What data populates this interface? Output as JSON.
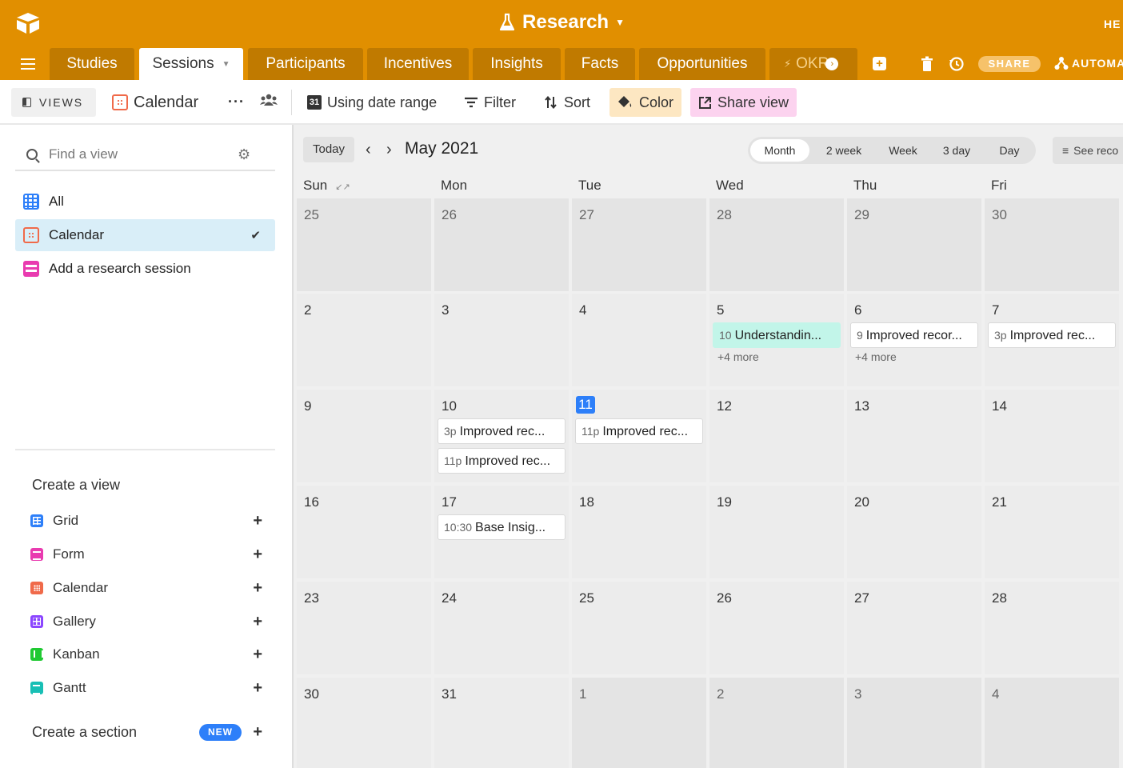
{
  "header": {
    "base_name": "Research",
    "help_label": "HE",
    "logo_icon": "airtable-logo-icon",
    "title_icon": "flask-icon"
  },
  "tabs": [
    {
      "label": "Studies",
      "active": false
    },
    {
      "label": "Sessions",
      "active": true
    },
    {
      "label": "Participants",
      "active": false
    },
    {
      "label": "Incentives",
      "active": false
    },
    {
      "label": "Insights",
      "active": false
    },
    {
      "label": "Facts",
      "active": false
    },
    {
      "label": "Opportunities",
      "active": false
    },
    {
      "label": "OKR",
      "active": false
    }
  ],
  "toolbar_right": {
    "share_label": "SHARE",
    "automations_label": "AUTOMA"
  },
  "viewbar": {
    "views_label": "VIEWS",
    "current_view": "Calendar",
    "date_range_label": "Using date range",
    "date_icon_text": "31",
    "filter_label": "Filter",
    "sort_label": "Sort",
    "color_label": "Color",
    "share_view_label": "Share view"
  },
  "sidebar": {
    "search_placeholder": "Find a view",
    "views": [
      {
        "label": "All",
        "icon": "grid-view-icon",
        "selected": false
      },
      {
        "label": "Calendar",
        "icon": "calendar-view-icon",
        "selected": true
      },
      {
        "label": "Add a research session",
        "icon": "form-view-icon",
        "selected": false
      }
    ],
    "create_view_heading": "Create a view",
    "create_options": [
      {
        "label": "Grid",
        "icon": "grid-icon"
      },
      {
        "label": "Form",
        "icon": "form-icon"
      },
      {
        "label": "Calendar",
        "icon": "calendar-icon"
      },
      {
        "label": "Gallery",
        "icon": "gallery-icon"
      },
      {
        "label": "Kanban",
        "icon": "kanban-icon"
      },
      {
        "label": "Gantt",
        "icon": "gantt-icon"
      }
    ],
    "create_section_label": "Create a section",
    "new_badge": "NEW"
  },
  "calendar": {
    "today_label": "Today",
    "month_label": "May 2021",
    "ranges": [
      "Month",
      "2 week",
      "Week",
      "3 day",
      "Day"
    ],
    "active_range": "Month",
    "see_records_label": "See reco",
    "weekdays": [
      "Sun",
      "Mon",
      "Tue",
      "Wed",
      "Thu",
      "Fri"
    ],
    "weeks": [
      [
        {
          "d": "25",
          "cur": false
        },
        {
          "d": "26",
          "cur": false
        },
        {
          "d": "27",
          "cur": false
        },
        {
          "d": "28",
          "cur": false
        },
        {
          "d": "29",
          "cur": false
        },
        {
          "d": "30",
          "cur": false
        }
      ],
      [
        {
          "d": "2",
          "cur": true
        },
        {
          "d": "3",
          "cur": true
        },
        {
          "d": "4",
          "cur": true
        },
        {
          "d": "5",
          "cur": true,
          "events": [
            {
              "time": "10",
              "title": "Understandin...",
              "teal": true
            }
          ],
          "more": "+4 more"
        },
        {
          "d": "6",
          "cur": true,
          "events": [
            {
              "time": "9",
              "title": "Improved recor..."
            }
          ],
          "more": "+4 more"
        },
        {
          "d": "7",
          "cur": true,
          "events": [
            {
              "time": "3p",
              "title": "Improved rec..."
            }
          ]
        }
      ],
      [
        {
          "d": "9",
          "cur": true
        },
        {
          "d": "10",
          "cur": true,
          "events": [
            {
              "time": "3p",
              "title": "Improved rec..."
            },
            {
              "time": "11p",
              "title": "Improved rec..."
            }
          ]
        },
        {
          "d": "11",
          "cur": true,
          "today": true,
          "events": [
            {
              "time": "11p",
              "title": "Improved rec..."
            }
          ]
        },
        {
          "d": "12",
          "cur": true
        },
        {
          "d": "13",
          "cur": true
        },
        {
          "d": "14",
          "cur": true
        }
      ],
      [
        {
          "d": "16",
          "cur": true
        },
        {
          "d": "17",
          "cur": true,
          "events": [
            {
              "time": "10:30",
              "title": "Base Insig..."
            }
          ]
        },
        {
          "d": "18",
          "cur": true
        },
        {
          "d": "19",
          "cur": true
        },
        {
          "d": "20",
          "cur": true
        },
        {
          "d": "21",
          "cur": true
        }
      ],
      [
        {
          "d": "23",
          "cur": true
        },
        {
          "d": "24",
          "cur": true
        },
        {
          "d": "25",
          "cur": true
        },
        {
          "d": "26",
          "cur": true
        },
        {
          "d": "27",
          "cur": true
        },
        {
          "d": "28",
          "cur": true
        }
      ],
      [
        {
          "d": "30",
          "cur": true
        },
        {
          "d": "31",
          "cur": true
        },
        {
          "d": "1",
          "cur": false
        },
        {
          "d": "2",
          "cur": false
        },
        {
          "d": "3",
          "cur": false
        },
        {
          "d": "4",
          "cur": false
        }
      ]
    ]
  },
  "colors": {
    "brand_orange": "#e18f00",
    "tab_orange": "#c07a00",
    "today_blue": "#2d7ff9",
    "event_teal": "#c2f5e9",
    "color_btn_bg": "#fde7c2",
    "share_view_bg": "#fcd3ef"
  }
}
